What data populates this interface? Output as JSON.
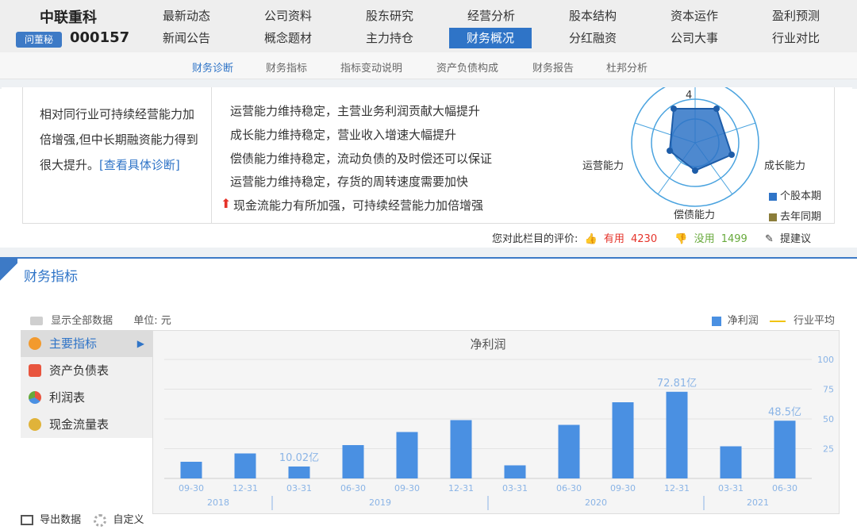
{
  "header": {
    "company": "中联重科",
    "badge": "问董秘",
    "code": "000157",
    "nav_row1": [
      "最新动态",
      "公司资料",
      "股东研究",
      "经营分析",
      "股本结构",
      "资本运作",
      "盈利预测"
    ],
    "nav_row2": [
      "新闻公告",
      "概念题材",
      "主力持仓",
      "财务概况",
      "分红融资",
      "公司大事",
      "行业对比"
    ],
    "active_nav": "财务概况"
  },
  "subnav": {
    "items": [
      "财务诊断",
      "财务指标",
      "指标变动说明",
      "资产负债构成",
      "财务报告",
      "杜邦分析"
    ],
    "active": "财务诊断"
  },
  "diagnosis": {
    "summary": "相对同行业可持续经营能力加倍增强,但中长期融资能力得到很大提升。",
    "summary_link": "[查看具体诊断]",
    "lines": [
      "运营能力维持稳定，主营业务利润贡献大幅提升",
      "成长能力维持稳定，营业收入增速大幅提升",
      "偿债能力维持稳定，流动负债的及时偿还可以保证",
      "运营能力维持稳定，存货的周转速度需要加快",
      "现金流能力有所加强，可持续经营能力加倍增强"
    ],
    "radar": {
      "top_value": "4",
      "label_left": "运营能力",
      "label_right": "成长能力",
      "label_bottom": "偿债能力",
      "legend": [
        {
          "name": "个股本期",
          "color": "#2f74c7"
        },
        {
          "name": "去年同期",
          "color": "#8b7d3a"
        }
      ]
    }
  },
  "rating": {
    "prompt": "您对此栏目的评价:",
    "useful_label": "有用",
    "useful_count": "4230",
    "useless_label": "没用",
    "useless_count": "1499",
    "suggest_label": "提建议"
  },
  "section": {
    "title": "财务指标",
    "show_all": "显示全部数据",
    "unit": "单位: 元",
    "legend_bar": "净利润",
    "legend_line": "行业平均",
    "menu": [
      "主要指标",
      "资产负债表",
      "利润表",
      "现金流量表"
    ],
    "menu_active": "主要指标",
    "export": "导出数据",
    "custom": "自定义"
  },
  "chart_data": {
    "type": "bar",
    "title": "净利润",
    "categories": [
      "09-30",
      "12-31",
      "03-31",
      "06-30",
      "09-30",
      "12-31",
      "03-31",
      "06-30",
      "09-30",
      "12-31",
      "03-31",
      "06-30"
    ],
    "years": [
      {
        "label": "2018",
        "span": [
          0,
          1
        ]
      },
      {
        "label": "2019",
        "span": [
          2,
          5
        ]
      },
      {
        "label": "2020",
        "span": [
          6,
          9
        ]
      },
      {
        "label": "2021",
        "span": [
          10,
          11
        ]
      }
    ],
    "values": [
      14,
      21,
      10.02,
      28,
      39,
      49,
      11,
      45,
      64,
      72.81,
      27,
      48.5
    ],
    "data_labels": {
      "2": "10.02亿",
      "9": "72.81亿",
      "11": "48.5亿"
    },
    "ylim": [
      0,
      100
    ],
    "yticks": [
      25,
      50,
      75,
      100
    ],
    "bar_color": "#4a90e2"
  }
}
